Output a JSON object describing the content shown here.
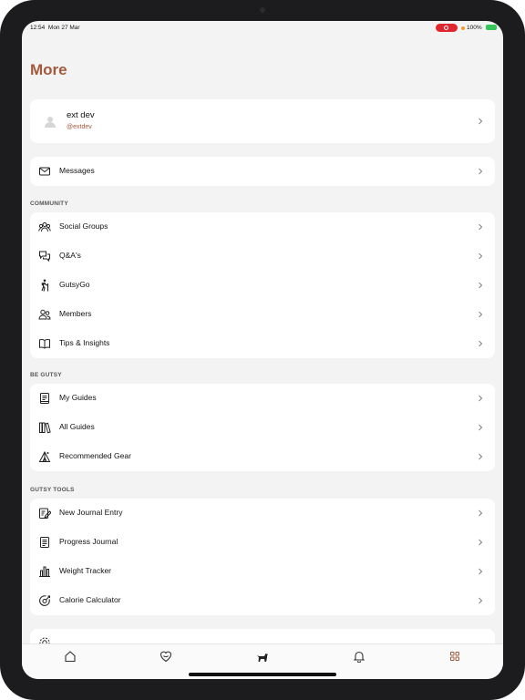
{
  "status_bar": {
    "time": "12:54",
    "date": "Mon 27 Mar",
    "battery": "100%"
  },
  "page": {
    "title": "More"
  },
  "profile": {
    "name": "ext dev",
    "handle": "@extdev",
    "icon": "avatar-icon"
  },
  "messages": {
    "label": "Messages",
    "icon": "envelope-icon"
  },
  "sections": [
    {
      "title": "COMMUNITY",
      "items": [
        {
          "label": "Social Groups",
          "icon": "group-icon"
        },
        {
          "label": "Q&A's",
          "icon": "chat-bubbles-icon"
        },
        {
          "label": "GutsyGo",
          "icon": "hiker-icon"
        },
        {
          "label": "Members",
          "icon": "members-icon"
        },
        {
          "label": "Tips & Insights",
          "icon": "book-icon"
        }
      ]
    },
    {
      "title": "BE GUTSY",
      "items": [
        {
          "label": "My Guides",
          "icon": "guide-icon"
        },
        {
          "label": "All Guides",
          "icon": "books-shelf-icon"
        },
        {
          "label": "Recommended Gear",
          "icon": "gear-tent-icon"
        }
      ]
    },
    {
      "title": "GUTSY TOOLS",
      "items": [
        {
          "label": "New Journal Entry",
          "icon": "journal-edit-icon"
        },
        {
          "label": "Progress Journal",
          "icon": "journal-icon"
        },
        {
          "label": "Weight Tracker",
          "icon": "weight-chart-icon"
        },
        {
          "label": "Calorie Calculator",
          "icon": "calorie-gauge-icon"
        }
      ]
    }
  ],
  "tab_bar": [
    {
      "name": "home",
      "icon": "home-icon"
    },
    {
      "name": "gut",
      "icon": "gut-heart-icon"
    },
    {
      "name": "dog",
      "icon": "dog-icon"
    },
    {
      "name": "notifications",
      "icon": "bell-icon"
    },
    {
      "name": "more",
      "icon": "grid-icon",
      "active": true
    }
  ],
  "colors": {
    "accent": "#a15a3c",
    "background": "#f4f3f3",
    "card": "#ffffff",
    "record": "#e0262e"
  }
}
